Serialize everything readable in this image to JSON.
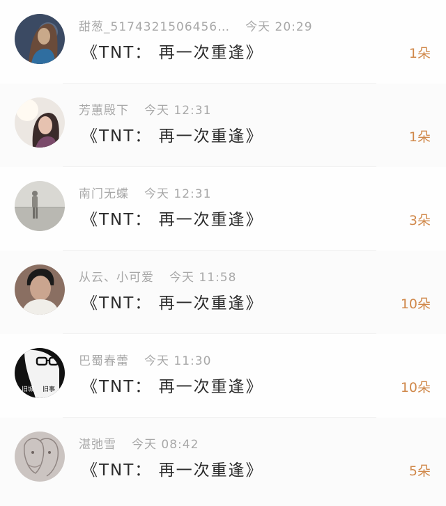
{
  "items": [
    {
      "username": "甜葱_5174321506456…",
      "time": "今天 20:29",
      "title": "《TNT： 再一次重逢》",
      "count": "1朵",
      "avatar_icon": "girl-long-hair-avatar",
      "avatar_colors": [
        "#3b4a63",
        "#c9a98a"
      ]
    },
    {
      "username": "芳蕙殿下",
      "time": "今天 12:31",
      "title": "《TNT： 再一次重逢》",
      "count": "1朵",
      "avatar_icon": "girl-sunlight-avatar",
      "avatar_colors": [
        "#ece7e2",
        "#3a2b2a"
      ]
    },
    {
      "username": "南门无蝶",
      "time": "今天 12:31",
      "title": "《TNT： 再一次重逢》",
      "count": "3朵",
      "avatar_icon": "beach-figure-avatar",
      "avatar_colors": [
        "#d9d8d3",
        "#7f7d78"
      ]
    },
    {
      "username": "从云、小可爱",
      "time": "今天 11:58",
      "title": "《TNT： 再一次重逢》",
      "count": "10朵",
      "avatar_icon": "boy-portrait-avatar",
      "avatar_colors": [
        "#caa58f",
        "#1a1a1a"
      ]
    },
    {
      "username": "巴蜀春蕾",
      "time": "今天 11:30",
      "title": "《TNT： 再一次重逢》",
      "count": "10朵",
      "avatar_icon": "glasses-bw-avatar",
      "avatar_colors": [
        "#f3f3f3",
        "#111111"
      ]
    },
    {
      "username": "湛弛雪",
      "time": "今天 08:42",
      "title": "《TNT： 再一次重逢》",
      "count": "5朵",
      "avatar_icon": "sketch-couple-avatar",
      "avatar_colors": [
        "#cbc4c1",
        "#9c908d"
      ]
    }
  ],
  "colors": {
    "count": "#d0884a",
    "meta": "#a8a8a8",
    "title": "#2c2c2c"
  }
}
